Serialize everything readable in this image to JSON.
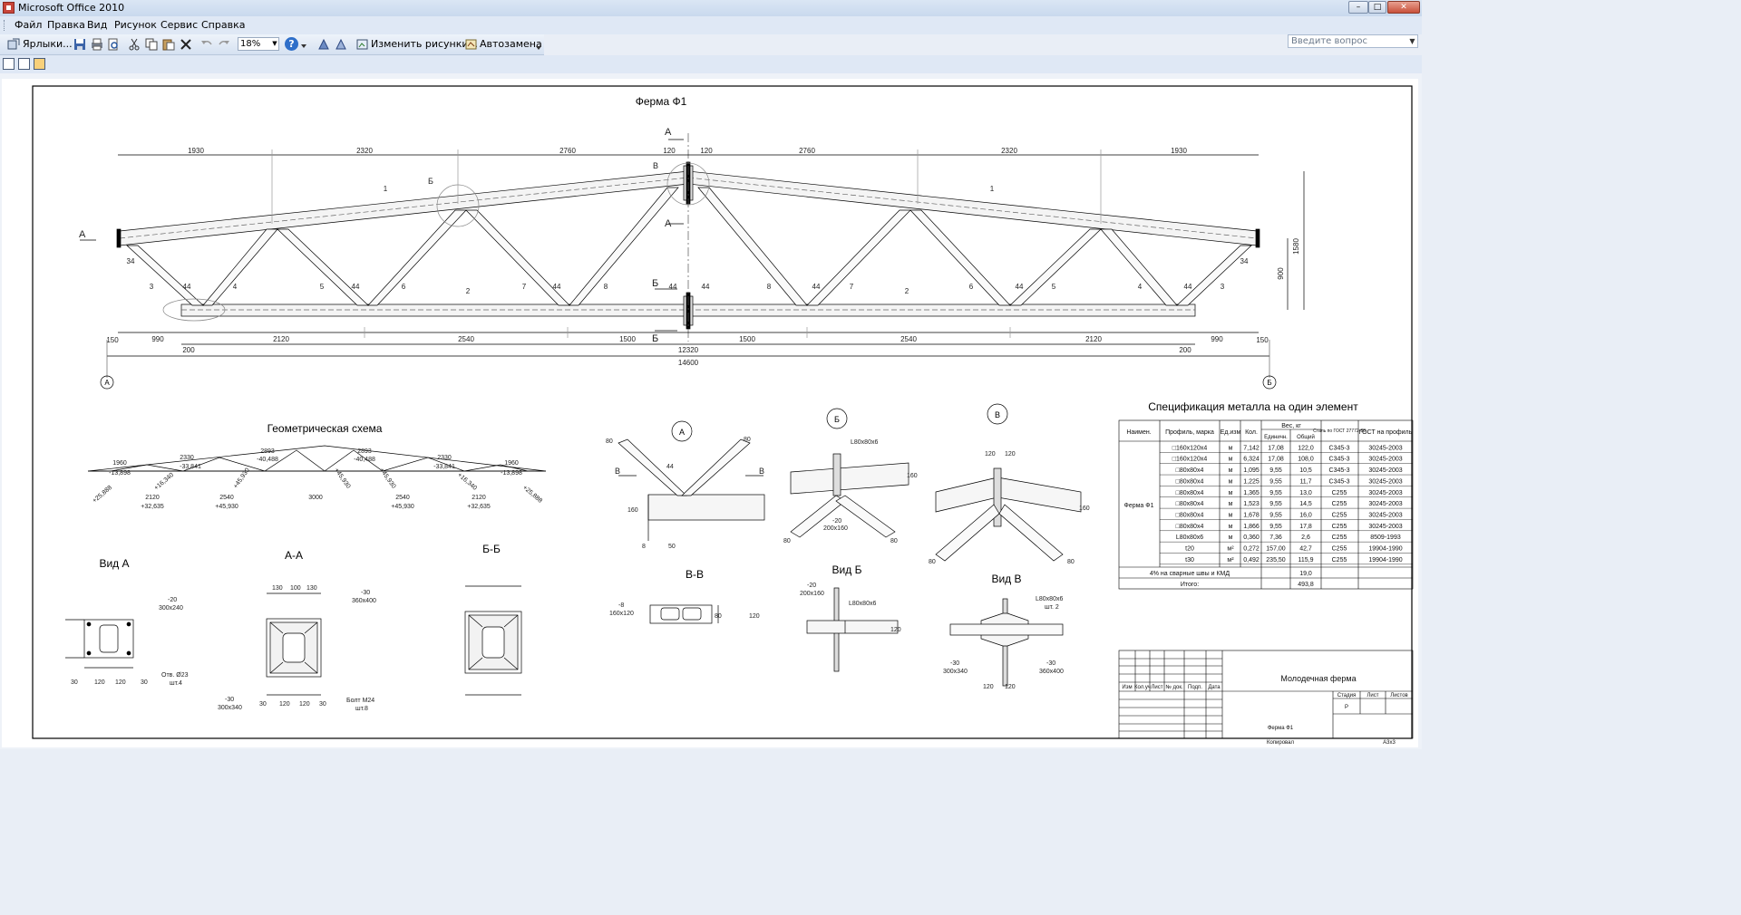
{
  "window": {
    "title": "Microsoft Office 2010",
    "controls": {
      "minimize": "–",
      "maximize": "□",
      "close": "✕"
    }
  },
  "menu": {
    "items": [
      "Файл",
      "Правка",
      "Вид",
      "Рисунок",
      "Сервис",
      "Справка"
    ],
    "help_placeholder": "Введите вопрос"
  },
  "toolbar": {
    "shortcuts_label": "Ярлыки...",
    "zoom": "18%",
    "edit_images_label": "Изменить рисунки...",
    "autocorrect_label": "Автозамена"
  },
  "drawing": {
    "truss_title": "Ферма Ф1",
    "top_dims": [
      "1930",
      "2320",
      "2760",
      "120",
      "120",
      "2760",
      "2320",
      "1930"
    ],
    "bottom_dims": [
      "150",
      "990",
      "2120",
      "2540",
      "1500",
      "1500",
      "2540",
      "2120",
      "990",
      "150"
    ],
    "small_dims": [
      "200",
      "200",
      "12320",
      "14600",
      "34",
      "34",
      "1580",
      "900"
    ],
    "member_labels": [
      "1",
      "1",
      "2",
      "2",
      "3",
      "3",
      "4",
      "4",
      "5",
      "5",
      "6",
      "6",
      "7",
      "7",
      "8",
      "8",
      "44",
      "44",
      "44",
      "44",
      "44",
      "44",
      "44",
      "44"
    ],
    "section_marks": [
      "А",
      "А",
      "А",
      "Б",
      "Б",
      "Б",
      "В"
    ],
    "axes": [
      "А",
      "Б"
    ],
    "geom_title": "Геометрическая схема",
    "geom_labels": [
      "1960",
      "2330",
      "2893",
      "2893",
      "2330",
      "1960",
      "-13,898",
      "-33,841",
      "-40,488",
      "-40,488",
      "-33,841",
      "-13,898",
      "+25,888",
      "+16,340",
      "+45,930",
      "+45,930",
      "+45,930",
      "+16,340",
      "+25,888",
      "2120",
      "2540",
      "3000",
      "2540",
      "2120",
      "+32,635",
      "+45,930",
      "+45,930",
      "+32,635"
    ],
    "node_a_title": "А",
    "node_b_title": "Б",
    "node_v_title": "В",
    "node_labels": [
      "80",
      "80",
      "44",
      "В",
      "В",
      "160",
      "8",
      "50",
      "L80x80x6",
      "-20",
      "200x160",
      "160",
      "80",
      "80",
      "120",
      "120",
      "160",
      "80",
      "80"
    ],
    "view_a_title": "Вид А",
    "section_aa_title": "А-А",
    "section_bb_title": "Б-Б",
    "section_vv_title": "В-В",
    "view_b_title": "Вид Б",
    "view_v_title": "Вид В",
    "view_labels": [
      "-20",
      "300x240",
      "Отв. Ø23",
      "шт.4",
      "30",
      "120",
      "120",
      "30",
      "130",
      "100",
      "130",
      "-30",
      "360x400",
      "-30",
      "300x340",
      "Болт М24",
      "шт.8",
      "30",
      "120",
      "120",
      "30",
      "-8",
      "160x120",
      "80",
      "120",
      "-20",
      "200x160",
      "L80x80x6",
      "120",
      "-30",
      "300x340",
      "-30",
      "360x400",
      "L80x80x6",
      "шт. 2",
      "120",
      "120"
    ],
    "spec_title": "Спецификация металла на один элемент",
    "spec_headers": [
      "Наимен.",
      "Профиль, марка",
      "Ед.изм",
      "Кол.",
      "Вес, кг",
      "Единичн.",
      "Общий",
      "Сталь по ГОСТ 27772-88",
      "ГОСТ на профиль"
    ],
    "spec_group": "Ферма Ф1",
    "spec_rows": [
      [
        "□160x120x4",
        "м",
        "7,142",
        "17,08",
        "122,0",
        "С345-3",
        "30245-2003"
      ],
      [
        "□160x120x4",
        "м",
        "6,324",
        "17,08",
        "108,0",
        "С345-3",
        "30245-2003"
      ],
      [
        "□80x80x4",
        "м",
        "1,095",
        "9,55",
        "10,5",
        "С345-3",
        "30245-2003"
      ],
      [
        "□80x80x4",
        "м",
        "1,225",
        "9,55",
        "11,7",
        "С345-3",
        "30245-2003"
      ],
      [
        "□80x80x4",
        "м",
        "1,365",
        "9,55",
        "13,0",
        "С255",
        "30245-2003"
      ],
      [
        "□80x80x4",
        "м",
        "1,523",
        "9,55",
        "14,5",
        "С255",
        "30245-2003"
      ],
      [
        "□80x80x4",
        "м",
        "1,678",
        "9,55",
        "16,0",
        "С255",
        "30245-2003"
      ],
      [
        "□80x80x4",
        "м",
        "1,866",
        "9,55",
        "17,8",
        "С255",
        "30245-2003"
      ],
      [
        "L80x80x6",
        "м",
        "0,360",
        "7,36",
        "2,6",
        "С255",
        "8509-1993"
      ],
      [
        "t20",
        "м²",
        "0,272",
        "157,00",
        "42,7",
        "С255",
        "19904-1990"
      ],
      [
        "t30",
        "м²",
        "0,492",
        "235,50",
        "115,9",
        "С255",
        "19904-1990"
      ]
    ],
    "spec_welds_label": "4% на сварные швы и КМД",
    "spec_welds_value": "19,0",
    "spec_total_label": "Итого:",
    "spec_total_value": "493,8",
    "stamp_title": "Молодечная ферма",
    "stamp_headers": [
      "Изм",
      "Кол.уч",
      "Лист",
      "№ док.",
      "Подп.",
      "Дата"
    ],
    "stamp_stage_headers": [
      "Стадия",
      "Лист",
      "Листов"
    ],
    "stamp_stage": "Р",
    "stamp_element": "Ферма Ф1",
    "footer_copied": "Копировал",
    "footer_format": "А3х3"
  }
}
